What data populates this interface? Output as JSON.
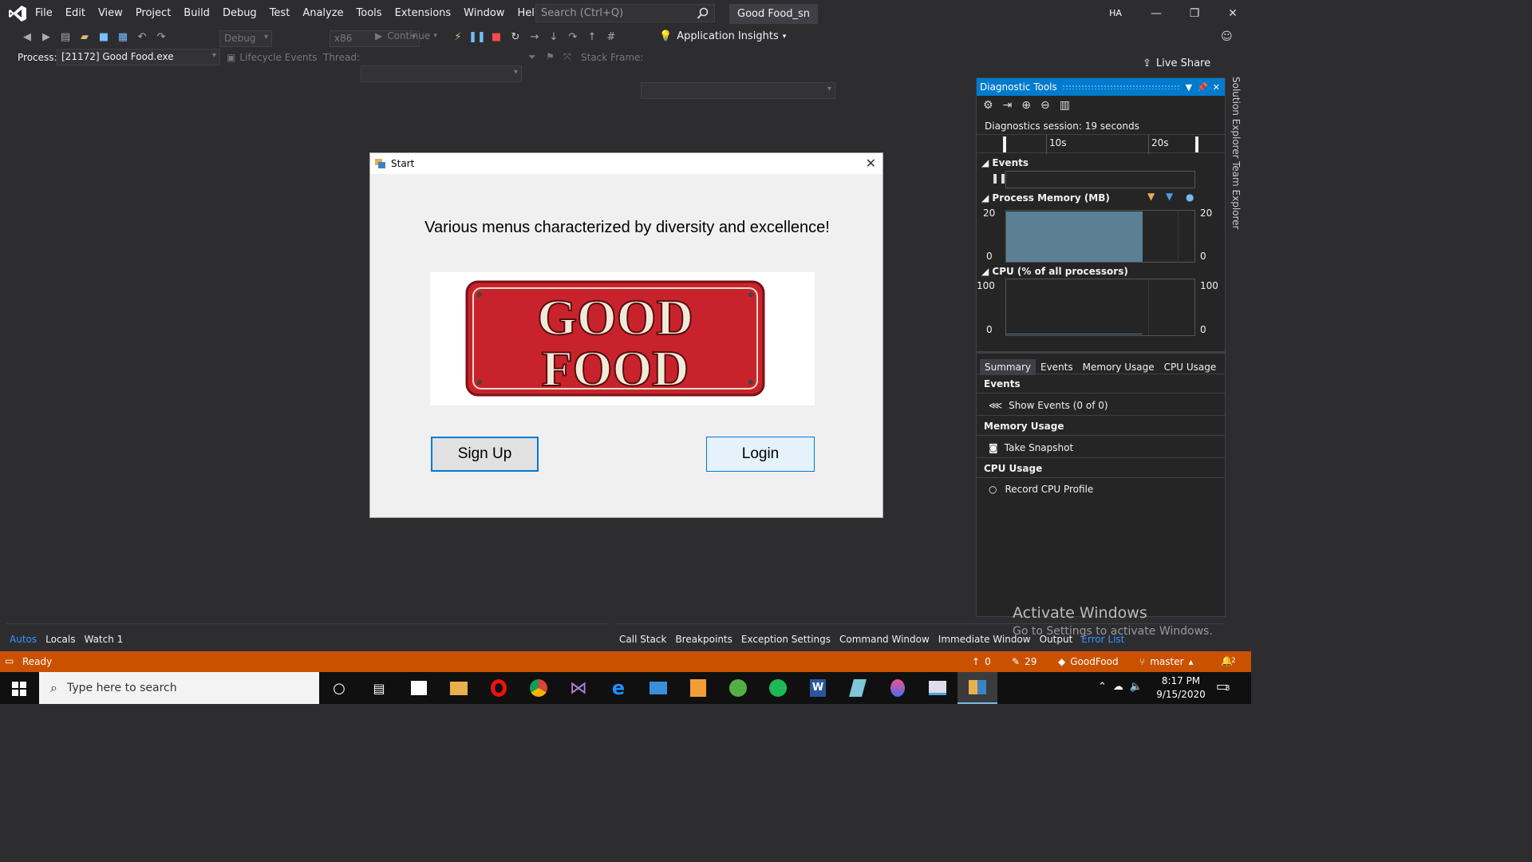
{
  "menubar": {
    "items": [
      "File",
      "Edit",
      "View",
      "Project",
      "Build",
      "Debug",
      "Test",
      "Analyze",
      "Tools",
      "Extensions",
      "Window",
      "Help"
    ],
    "search_placeholder": "Search (Ctrl+Q)",
    "solution_name": "Good Food_sn",
    "avatar_initials": "HA"
  },
  "toolbar": {
    "config": "Debug",
    "platform": "x86",
    "continue_label": "Continue",
    "app_insights": "Application Insights",
    "live_share": "Live Share"
  },
  "locbar": {
    "process_label": "Process:",
    "process_value": "[21172] Good Food.exe",
    "lifecycle": "Lifecycle Events",
    "thread_label": "Thread:",
    "stack_label": "Stack Frame:"
  },
  "dialog": {
    "title": "Start",
    "headline": "Various menus characterized by diversity and excellence!",
    "logo_text_1": "GOOD",
    "logo_text_2": "FOOD",
    "signup": "Sign Up",
    "login": "Login"
  },
  "diag": {
    "title": "Diagnostic Tools",
    "session": "Diagnostics session: 19 seconds",
    "tick1": "10s",
    "tick2": "20s",
    "events": "Events",
    "process_memory": "Process Memory (MB)",
    "mem_max": "20",
    "mem_min": "0",
    "cpu": "CPU (% of all processors)",
    "cpu_max": "100",
    "cpu_min": "0",
    "tabs": [
      "Summary",
      "Events",
      "Memory Usage",
      "CPU Usage"
    ],
    "sec_events": "Events",
    "show_events": "Show Events (0 of 0)",
    "sec_memory": "Memory Usage",
    "take_snapshot": "Take Snapshot",
    "sec_cpu": "CPU Usage",
    "record_cpu": "Record CPU Profile",
    "memory_fill_fraction": 0.98
  },
  "side_tabs": [
    "Solution Explorer",
    "Team Explorer"
  ],
  "bottom_left_tabs": [
    "Autos",
    "Locals",
    "Watch 1"
  ],
  "bottom_right_tabs": [
    "Call Stack",
    "Breakpoints",
    "Exception Settings",
    "Command Window",
    "Immediate Window",
    "Output",
    "Error List"
  ],
  "status": {
    "ready": "Ready",
    "up_count": "0",
    "pencil_count": "29",
    "repo": "GoodFood",
    "branch": "master",
    "notifications": "2"
  },
  "activation": {
    "line1": "Activate Windows",
    "line2": "Go to Settings to activate Windows."
  },
  "taskbar": {
    "search_placeholder": "Type here to search",
    "time": "8:17 PM",
    "date": "9/15/2020",
    "notif_count": "3"
  },
  "colors": {
    "accent": "#007acc",
    "status_bar": "#ca5100",
    "logo_red": "#c8232c"
  }
}
